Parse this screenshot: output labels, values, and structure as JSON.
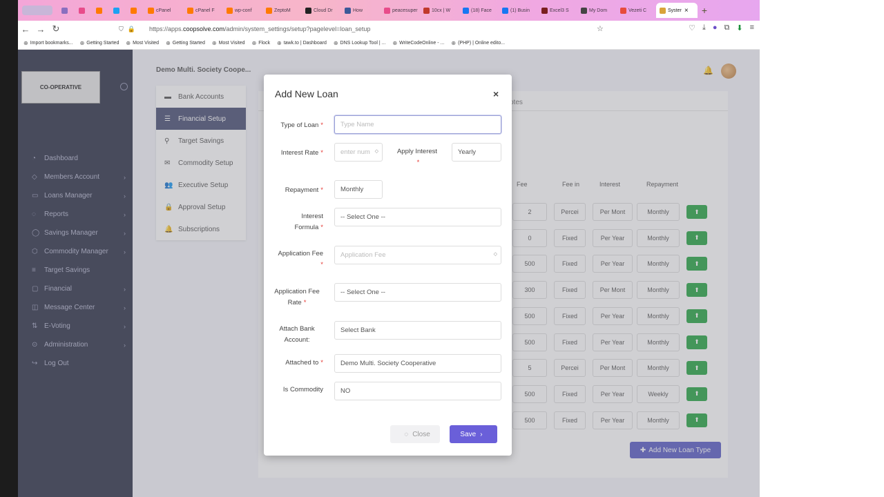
{
  "browser": {
    "tabs": [
      {
        "label": "",
        "color": "#8a6fbf"
      },
      {
        "label": "",
        "color": "#e84c8a"
      },
      {
        "label": "",
        "color": "#ff7a00"
      },
      {
        "label": "",
        "color": "#1da1f2"
      },
      {
        "label": "",
        "color": "#ff7a00"
      },
      {
        "label": "cPanel",
        "color": "#ff7a00"
      },
      {
        "label": "cPanel F",
        "color": "#ff7a00"
      },
      {
        "label": "wp-conf",
        "color": "#ff7a00"
      },
      {
        "label": "ZeptoM",
        "color": "#ff7a00"
      },
      {
        "label": "Cloud Dr",
        "color": "#222222"
      },
      {
        "label": "How",
        "color": "#3b5998"
      },
      {
        "label": "peacesuper",
        "color": "#e84c8a"
      },
      {
        "label": "10cx | W",
        "color": "#c0392b"
      },
      {
        "label": "(18) Face",
        "color": "#1877f2"
      },
      {
        "label": "(1) Busin",
        "color": "#1877f2"
      },
      {
        "label": "Excel3 S",
        "color": "#7a1f1f"
      },
      {
        "label": "My Dom",
        "color": "#444444"
      },
      {
        "label": "Vezeti C",
        "color": "#e74c3c"
      }
    ],
    "active_tab": "Syster",
    "url_prefix": "https://apps.",
    "url_host": "coopsolve.com",
    "url_path": "/admin/system_settings/setup?pagelevel=loan_setup",
    "bookmarks": [
      "Import bookmarks...",
      "Getting Started",
      "Most Visited",
      "Getting Started",
      "Most Visited",
      "Flock",
      "tawk.to | Dashboard",
      "DNS Lookup Tool | ...",
      "WriteCodeOnline - ...",
      "(PHP) | Online edito..."
    ]
  },
  "app": {
    "logo_text": "CO-OPERATIVE",
    "org_title": "Demo Multi. Society Coope...",
    "sidebar": [
      {
        "label": "Dashboard",
        "icon": "◔",
        "chevron": false
      },
      {
        "label": "Members Account",
        "icon": "◇",
        "chevron": true
      },
      {
        "label": "Loans Manager",
        "icon": "▭",
        "chevron": true
      },
      {
        "label": "Reports",
        "icon": "◌",
        "chevron": true
      },
      {
        "label": "Savings Manager",
        "icon": "◯",
        "chevron": true
      },
      {
        "label": "Commodity Manager",
        "icon": "⬡",
        "chevron": true
      },
      {
        "label": "Target Savings",
        "icon": "≡",
        "chevron": false
      },
      {
        "label": "Financial",
        "icon": "▢",
        "chevron": true
      },
      {
        "label": "Message Center",
        "icon": "◫",
        "chevron": true
      },
      {
        "label": "E-Voting",
        "icon": "⇅",
        "chevron": true
      },
      {
        "label": "Administration",
        "icon": "⊙",
        "chevron": true
      },
      {
        "label": "Log Out",
        "icon": "↪",
        "chevron": false
      }
    ],
    "settings_menu": [
      {
        "label": "Bank Accounts",
        "icon": "▬",
        "active": false
      },
      {
        "label": "Financial Setup",
        "icon": "☰",
        "active": true
      },
      {
        "label": "Target Savings",
        "icon": "⚲",
        "active": false
      },
      {
        "label": "Commodity Setup",
        "icon": "✉",
        "active": false
      },
      {
        "label": "Executive Setup",
        "icon": "👥",
        "active": false
      },
      {
        "label": "Approval Setup",
        "icon": "🔒",
        "active": false
      },
      {
        "label": "Subscriptions",
        "icon": "🔔",
        "active": false
      }
    ],
    "notes_tab": "otes",
    "table": {
      "headers": [
        "Fee",
        "Fee in",
        "Interest",
        "Repayment"
      ],
      "rows": [
        [
          "2",
          "Percei",
          "Per Mont",
          "Monthly"
        ],
        [
          "0",
          "Fixed",
          "Per Year",
          "Monthly"
        ],
        [
          "500",
          "Fixed",
          "Per Year",
          "Monthly"
        ],
        [
          "300",
          "Fixed",
          "Per Mont",
          "Monthly"
        ],
        [
          "500",
          "Fixed",
          "Per Year",
          "Monthly"
        ],
        [
          "500",
          "Fixed",
          "Per Year",
          "Monthly"
        ],
        [
          "5",
          "Percei",
          "Per Mont",
          "Monthly"
        ],
        [
          "500",
          "Fixed",
          "Per Year",
          "Weekly"
        ],
        [
          "500",
          "Fixed",
          "Per Year",
          "Monthly"
        ]
      ]
    },
    "add_loan_type": "Add New Loan Type"
  },
  "modal": {
    "title": "Add New Loan",
    "close_symbol": "×",
    "fields": {
      "type_of_loan": {
        "label": "Type of Loan",
        "placeholder": "Type Name"
      },
      "interest_rate": {
        "label": "Interest Rate",
        "placeholder": "enter num"
      },
      "apply_interest": {
        "label": "Apply Interest",
        "value": "Yearly"
      },
      "repayment": {
        "label": "Repayment",
        "value": "Monthly"
      },
      "interest_formula": {
        "label_1": "Interest",
        "label_2": "Formula",
        "value": "-- Select One --"
      },
      "application_fee": {
        "label": "Application Fee",
        "placeholder": "Application Fee"
      },
      "application_fee_rate": {
        "label_1": "Application Fee",
        "label_2": "Rate",
        "value": "-- Select One --"
      },
      "attach_bank": {
        "label_1": "Attach Bank",
        "label_2": "Account:",
        "value": "Select Bank"
      },
      "attached_to": {
        "label": "Attached to",
        "value": "Demo Multi. Society Cooperative"
      },
      "is_commodity": {
        "label": "Is Commodity",
        "value": "NO"
      }
    },
    "close_button": "Close",
    "save_button": "Save"
  }
}
